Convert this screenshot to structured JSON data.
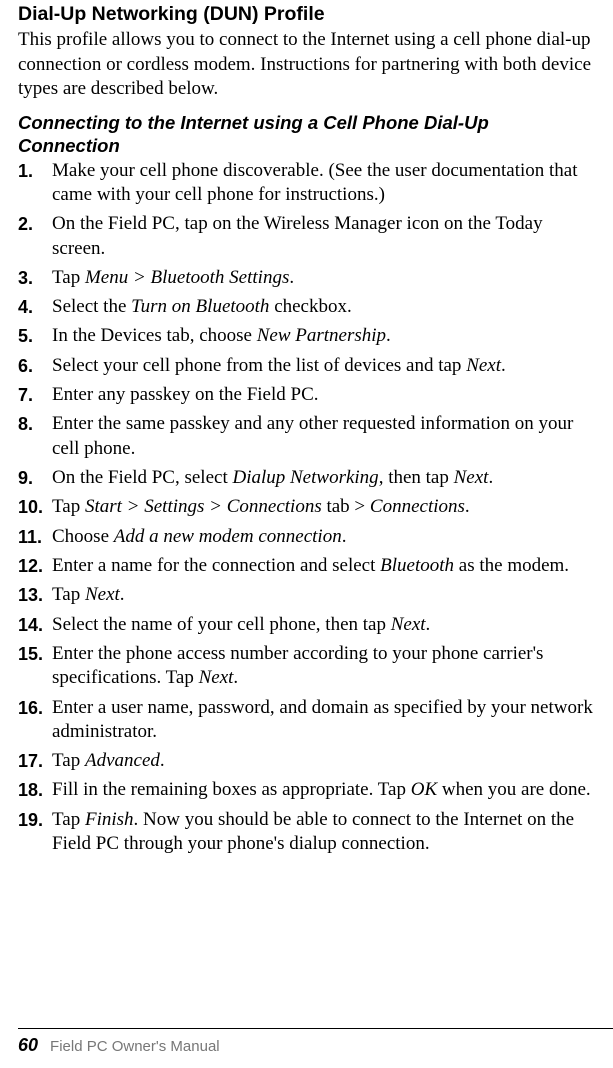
{
  "heading": "Dial-Up Networking (DUN) Profile",
  "intro": "This profile allows you to connect to the Internet using a cell phone dial-up connection or cordless modem. Instructions for partnering with both device types are described below.",
  "subheading": "Connecting to the Internet using a Cell Phone Dial-Up Connection",
  "steps": [
    {
      "n": "1.",
      "pre": "Make your cell phone discoverable. (See the user documentation that came with your cell phone for instructions.)"
    },
    {
      "n": "2.",
      "pre": "On the Field PC, tap on the Wireless Manager icon on the Today screen."
    },
    {
      "n": "3.",
      "pre": "Tap ",
      "i1": "Menu > Bluetooth Settings",
      "post1": "."
    },
    {
      "n": "4.",
      "pre": "Select the ",
      "i1": "Turn on Bluetooth",
      "post1": " checkbox."
    },
    {
      "n": "5.",
      "pre": "In the Devices tab, choose ",
      "i1": "New Partnership",
      "post1": "."
    },
    {
      "n": "6.",
      "pre": "Select your cell phone from the list of devices and tap ",
      "i1": "Next",
      "post1": "."
    },
    {
      "n": "7.",
      "pre": "Enter any passkey on the Field PC."
    },
    {
      "n": "8.",
      "pre": "Enter the same passkey and any other requested information on your cell phone."
    },
    {
      "n": "9.",
      "pre": "On the Field PC, select ",
      "i1": "Dialup Networking",
      "post1": ", then tap ",
      "i2": "Next",
      "post2": "."
    },
    {
      "n": "10.",
      "pre": "Tap ",
      "i1": "Start > Settings > Connections",
      "post1": " tab > ",
      "i2": "Connections",
      "post2": "."
    },
    {
      "n": "11.",
      "pre": "Choose ",
      "i1": "Add a new modem connection",
      "post1": "."
    },
    {
      "n": "12.",
      "pre": "Enter a name for the connection and select ",
      "i1": "Bluetooth",
      "post1": " as the modem."
    },
    {
      "n": "13.",
      "pre": "Tap ",
      "i1": "Next",
      "post1": "."
    },
    {
      "n": "14.",
      "pre": "Select the name of your cell phone, then tap ",
      "i1": "Next",
      "post1": "."
    },
    {
      "n": "15.",
      "pre": "Enter the phone access number according to your phone carrier's specifications. Tap ",
      "i1": "Next",
      "post1": "."
    },
    {
      "n": "16.",
      "pre": "Enter a user name, password, and domain as specified by your network administrator."
    },
    {
      "n": "17.",
      "pre": "Tap ",
      "i1": "Advanced",
      "post1": "."
    },
    {
      "n": "18.",
      "pre": "Fill in the remaining boxes as appropriate. Tap ",
      "i1": "OK",
      "post1": " when you are done."
    },
    {
      "n": "19.",
      "pre": "Tap ",
      "i1": "Finish",
      "post1": ". Now you should be able to connect to the Internet on the Field PC through your phone's dialup connection."
    }
  ],
  "footer": {
    "page": "60",
    "title": "Field PC Owner's Manual"
  }
}
